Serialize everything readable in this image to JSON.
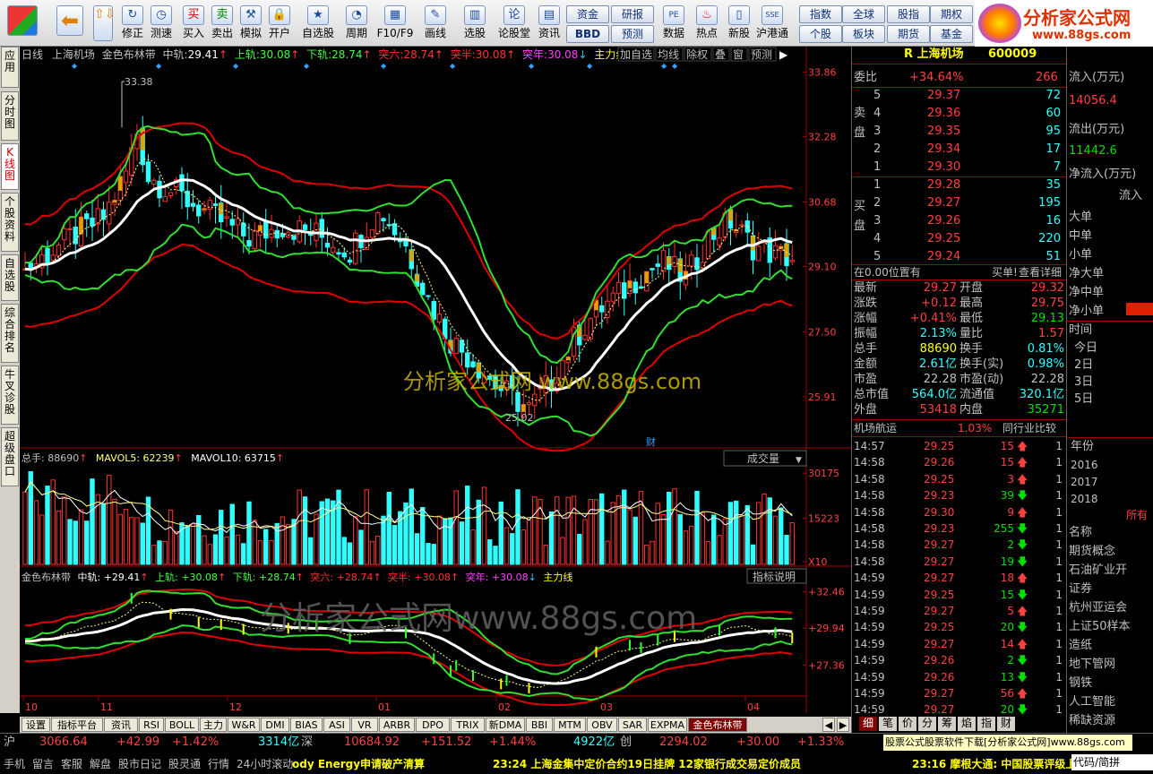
{
  "toolbar": {
    "buttons": [
      "修正",
      "测速",
      "买入",
      "卖出",
      "模拟",
      "开户",
      "自选股",
      "周期",
      "F10/F9",
      "画线",
      "选股",
      "论股堂",
      "资讯",
      "数据",
      "热点",
      "新股",
      "沪港通"
    ],
    "small": [
      "资金",
      "研报",
      "BBD",
      "预测",
      "指数",
      "全球",
      "股指",
      "期权",
      "个股",
      "板块",
      "期货",
      "基金"
    ],
    "logo_text": "分析家公式网",
    "logo_url": "www.88gs.com"
  },
  "vtabs": [
    "应用",
    "分时图",
    "K线图",
    "个股资料",
    "自选股",
    "综合排名",
    "牛叉诊股",
    "超级盘口"
  ],
  "chart": {
    "header": {
      "period": "日线",
      "stock": "上海机场",
      "indicator": "金色布林带",
      "mid_label": "中轨:",
      "mid": "29.41",
      "up_label": "上轨:",
      "up": "30.08",
      "dn_label": "下轨:",
      "dn": "28.74",
      "tl_label": "突六:",
      "tl": "28.74",
      "tb_label": "突半:",
      "tb": "30.08",
      "tn_label": "突年:",
      "tn": "30.08",
      "zl_label": "主力线:",
      "btns": [
        "加自选",
        "均线",
        "除权",
        "叠",
        "窗",
        "预测"
      ]
    },
    "price_axis": [
      "33.86",
      "32.28",
      "30.68",
      "29.10",
      "27.50",
      "25.91"
    ],
    "high_mark": "33.38",
    "low_mark": "25.02",
    "cai": "财",
    "watermark1": "分析家公式网 www.88gs.com",
    "vol_header": {
      "total": "总手: 88690",
      "mavol5": "MAVOL5: 62239",
      "mavol10": "MAVOL10: 63715",
      "select": "成交量"
    },
    "vol_axis": [
      "30175",
      "15223",
      "X10"
    ],
    "ind_header": {
      "name": "金色布林带",
      "mid": "中轨: +29.41",
      "up": "上轨: +30.08",
      "dn": "下轨: +28.74",
      "tl": "突六: +28.74",
      "tb": "突半: +30.08",
      "tn": "突年: +30.08",
      "zl": "主力线",
      "btn": "指标说明"
    },
    "ind_axis": [
      "+32.46",
      "+29.94",
      "+27.36"
    ],
    "watermark2": "分析家公式网www.88gs.com",
    "months": [
      "10",
      "11",
      "12",
      "01",
      "02",
      "03",
      "04"
    ]
  },
  "bottabs": [
    "设置",
    "指标平台",
    "资讯",
    "RSI",
    "BOLL",
    "主力",
    "W&R",
    "DMI",
    "BIAS",
    "ASI",
    "VR",
    "ARBR",
    "DPO",
    "TRIX",
    "新DMA",
    "BBI",
    "MTM",
    "OBV",
    "SAR",
    "EXPMA",
    "金色布林带"
  ],
  "quote": {
    "title": "R 上海机场",
    "code": "600009",
    "weibi_label": "委比",
    "weibi": "+34.64%",
    "weibi_v": "266",
    "sell_label": "卖盘",
    "buy_label": "买盘",
    "sells": [
      {
        "n": "5",
        "p": "29.37",
        "v": "72"
      },
      {
        "n": "4",
        "p": "29.36",
        "v": "60"
      },
      {
        "n": "3",
        "p": "29.35",
        "v": "95"
      },
      {
        "n": "2",
        "p": "29.34",
        "v": "17"
      },
      {
        "n": "1",
        "p": "29.30",
        "v": "7"
      }
    ],
    "buys": [
      {
        "n": "1",
        "p": "29.28",
        "v": "35"
      },
      {
        "n": "2",
        "p": "29.27",
        "v": "195"
      },
      {
        "n": "3",
        "p": "29.26",
        "v": "16"
      },
      {
        "n": "4",
        "p": "29.25",
        "v": "220"
      },
      {
        "n": "5",
        "p": "29.24",
        "v": "51"
      }
    ],
    "pos": "在0.00位置有",
    "buy1": "买单!",
    "detail": "查看详细",
    "stats": [
      [
        "最新",
        "29.27",
        "开盘",
        "29.32"
      ],
      [
        "涨跌",
        "+0.12",
        "最高",
        "29.75"
      ],
      [
        "涨幅",
        "+0.41%",
        "最低",
        "29.13"
      ],
      [
        "振幅",
        "2.13%",
        "量比",
        "1.57"
      ],
      [
        "总手",
        "88690",
        "换手",
        "0.81%"
      ],
      [
        "金额",
        "2.61亿",
        "换手(实)",
        "0.98%"
      ],
      [
        "市盈",
        "22.28",
        "市盈(动)",
        "22.28"
      ],
      [
        "总市值",
        "564.0亿",
        "流通值",
        "320.1亿"
      ],
      [
        "外盘",
        "53418",
        "内盘",
        "35271"
      ]
    ],
    "sector": "机场航运",
    "sector_pct": "1.03%",
    "peer": "同行业比较",
    "ticks": [
      [
        "14:57",
        "29.25",
        "15",
        "up"
      ],
      [
        "14:58",
        "29.26",
        "15",
        "up"
      ],
      [
        "14:58",
        "29.25",
        "3",
        "up"
      ],
      [
        "14:58",
        "29.23",
        "39",
        "dn"
      ],
      [
        "14:58",
        "29.30",
        "9",
        "up"
      ],
      [
        "14:58",
        "29.23",
        "255",
        "dn"
      ],
      [
        "14:58",
        "29.27",
        "2",
        "dn"
      ],
      [
        "14:58",
        "29.27",
        "19",
        "dn"
      ],
      [
        "14:59",
        "29.27",
        "18",
        "up"
      ],
      [
        "14:59",
        "29.25",
        "15",
        "dn"
      ],
      [
        "14:59",
        "29.27",
        "5",
        "up"
      ],
      [
        "14:59",
        "29.25",
        "20",
        "dn"
      ],
      [
        "14:59",
        "29.27",
        "14",
        "up"
      ],
      [
        "14:59",
        "29.26",
        "2",
        "dn"
      ],
      [
        "14:59",
        "29.26",
        "13",
        "dn"
      ],
      [
        "14:59",
        "29.27",
        "56",
        "up"
      ],
      [
        "14:59",
        "29.27",
        "20",
        "dn"
      ]
    ],
    "tabs": [
      "细",
      "笔",
      "价",
      "分",
      "筹",
      "焰",
      "指",
      "财"
    ]
  },
  "far": {
    "liuru": "流入(万元)",
    "liuru_v": "14056.4",
    "liuchu": "流出(万元)",
    "liuchu_v": "11442.6",
    "jl": "净流入(万元)",
    "liu": "流入",
    "orders": [
      "大单",
      "中单",
      "小单",
      "净大单",
      "净中单",
      "净小单"
    ],
    "time": "时间",
    "days": [
      "今日",
      "2日",
      "3日",
      "5日"
    ],
    "year": "年份",
    "years": [
      "2016",
      "2017",
      "2018"
    ],
    "suo": "所有",
    "name": "名称",
    "concepts": [
      "期货概念",
      "石油矿业开",
      "证券",
      "杭州亚运会",
      "上证50样本",
      "造纸",
      "地下管网",
      "钢铁",
      "人工智能",
      "稀缺资源"
    ]
  },
  "status": {
    "sh": "沪",
    "sh_v": "3066.64",
    "sh_c": "+42.99",
    "sh_p": "+1.42%",
    "sh_amt": "3314亿",
    "sz": "深",
    "sz_v": "10684.92",
    "sz_c": "+151.52",
    "sz_p": "+1.44%",
    "sz_amt": "4922亿",
    "cy": "创",
    "cy_v": "2294.02",
    "cy_c": "+30.00",
    "cy_p": "+1.33%",
    "ad": "股票公式股票软件下载[分析家公式网]www.88gs.com",
    "menu": [
      "手机",
      "留言",
      "客服",
      "解盘",
      "股市日记",
      "股灵通",
      "行情",
      "24小时滚动"
    ],
    "news1": "ody Energy申请破产清算",
    "news2": "23:24 上海金集中定价合约19日挂牌 12家银行成交易定价成员",
    "news3": "23:16 摩根大通: 中国股票评级上调",
    "news4": "代码/简拼"
  }
}
